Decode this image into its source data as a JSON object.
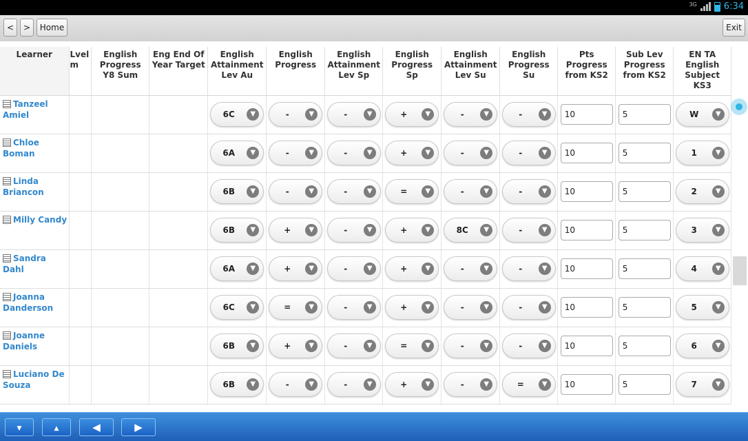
{
  "status_bar": {
    "network": "3G",
    "time": "6:34"
  },
  "toolbar": {
    "back_label": "<",
    "forward_label": ">",
    "home_label": "Home",
    "exit_label": "Exit"
  },
  "columns": {
    "learner": "Learner",
    "partial": "Lvel\nm",
    "progress_y8": "English Progress Y8 Sum",
    "end_target": "Eng End Of Year Target",
    "att_au": "English Attainment Lev Au",
    "prog": "English Progress",
    "att_sp": "English Attainment Lev Sp",
    "prog_sp": "English Progress Sp",
    "att_su": "English Attainment Lev Su",
    "prog_su": "English Progress Su",
    "pts_progress": "Pts Progress from KS2",
    "sub_lev": "Sub Lev Progress from KS2",
    "ta_ks3": "EN TA English Subject KS3"
  },
  "rows": [
    {
      "name": "Tanzeel Amiel",
      "att_au": "6C",
      "prog": "-",
      "att_sp": "-",
      "prog_sp": "+",
      "att_su": "-",
      "prog_su": "-",
      "pts": "10",
      "sub": "5",
      "ta": "W"
    },
    {
      "name": "Chloe Boman",
      "att_au": "6A",
      "prog": "-",
      "att_sp": "-",
      "prog_sp": "+",
      "att_su": "-",
      "prog_su": "-",
      "pts": "10",
      "sub": "5",
      "ta": "1"
    },
    {
      "name": "Linda Briancon",
      "att_au": "6B",
      "prog": "-",
      "att_sp": "-",
      "prog_sp": "=",
      "att_su": "-",
      "prog_su": "-",
      "pts": "10",
      "sub": "5",
      "ta": "2"
    },
    {
      "name": "Milly Candy",
      "att_au": "6B",
      "prog": "+",
      "att_sp": "-",
      "prog_sp": "+",
      "att_su": "8C",
      "prog_su": "-",
      "pts": "10",
      "sub": "5",
      "ta": "3"
    },
    {
      "name": "Sandra Dahl",
      "att_au": "6A",
      "prog": "+",
      "att_sp": "-",
      "prog_sp": "+",
      "att_su": "-",
      "prog_su": "-",
      "pts": "10",
      "sub": "5",
      "ta": "4"
    },
    {
      "name": "Joanna Danderson",
      "att_au": "6C",
      "prog": "=",
      "att_sp": "-",
      "prog_sp": "+",
      "att_su": "-",
      "prog_su": "-",
      "pts": "10",
      "sub": "5",
      "ta": "5"
    },
    {
      "name": "Joanne Daniels",
      "att_au": "6B",
      "prog": "+",
      "att_sp": "-",
      "prog_sp": "=",
      "att_su": "-",
      "prog_su": "-",
      "pts": "10",
      "sub": "5",
      "ta": "6"
    },
    {
      "name": "Luciano De Souza",
      "att_au": "6B",
      "prog": "-",
      "att_sp": "-",
      "prog_sp": "+",
      "att_su": "-",
      "prog_su": "=",
      "pts": "10",
      "sub": "5",
      "ta": "7"
    }
  ],
  "bottom_nav": {
    "down_icon": "arrow-down-icon",
    "up_icon": "arrow-up-icon",
    "left_icon": "arrow-left-icon",
    "right_icon": "arrow-right-icon"
  },
  "colors": {
    "accent": "#33b5e5",
    "link": "#3388cc",
    "bottom_bar": "#2a74cc"
  }
}
